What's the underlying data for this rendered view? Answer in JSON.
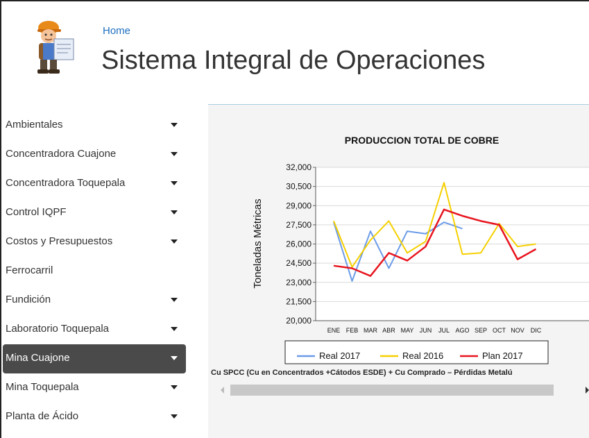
{
  "header": {
    "breadcrumb": "Home",
    "title": "Sistema Integral de Operaciones"
  },
  "sidebar": {
    "items": [
      {
        "label": "Ambientales",
        "has_caret": true,
        "active": false
      },
      {
        "label": "Concentradora Cuajone",
        "has_caret": true,
        "active": false
      },
      {
        "label": "Concentradora Toquepala",
        "has_caret": true,
        "active": false
      },
      {
        "label": "Control IQPF",
        "has_caret": true,
        "active": false
      },
      {
        "label": "Costos y Presupuestos",
        "has_caret": true,
        "active": false
      },
      {
        "label": "Ferrocarril",
        "has_caret": false,
        "active": false
      },
      {
        "label": "Fundición",
        "has_caret": true,
        "active": false
      },
      {
        "label": "Laboratorio Toquepala",
        "has_caret": true,
        "active": false
      },
      {
        "label": "Mina Cuajone",
        "has_caret": true,
        "active": true
      },
      {
        "label": "Mina Toquepala",
        "has_caret": true,
        "active": false
      },
      {
        "label": "Planta de Ácido",
        "has_caret": true,
        "active": false
      }
    ]
  },
  "footer_note": "Cu SPCC (Cu en Concentrados +Cátodos ESDE) + Cu Comprado – Pérdidas Metalú",
  "colors": {
    "real_2017": "#6b9be8",
    "real_2016": "#f5d000",
    "plan_2017": "#e8141e",
    "active_nav_bg": "#4a4a4a",
    "link": "#1e6fc0"
  },
  "icons": {
    "logo": "worker-with-blueprint-icon",
    "nav_caret": "caret-down-icon"
  },
  "chart_data": {
    "type": "line",
    "title": "PRODUCCION TOTAL DE COBRE",
    "xlabel": "",
    "ylabel": "Toneladas Métricas",
    "categories": [
      "ENE",
      "FEB",
      "MAR",
      "ABR",
      "MAY",
      "JUN",
      "JUL",
      "AGO",
      "SEP",
      "OCT",
      "NOV",
      "DIC"
    ],
    "ylim": [
      20000,
      32000
    ],
    "yticks": [
      "20,000",
      "21,500",
      "23,000",
      "24,500",
      "26,000",
      "27,500",
      "29,000",
      "30,500",
      "32,000"
    ],
    "ytick_values": [
      20000,
      21500,
      23000,
      24500,
      26000,
      27500,
      29000,
      30500,
      32000
    ],
    "grid": true,
    "legend_position": "bottom",
    "series": [
      {
        "name": "Real 2017",
        "color": "#6b9be8",
        "values": [
          27700,
          23100,
          27000,
          24100,
          27000,
          26800,
          27700,
          27200,
          null,
          null,
          null,
          null
        ]
      },
      {
        "name": "Real 2016",
        "color": "#f5d000",
        "values": [
          27800,
          24200,
          26300,
          27800,
          25300,
          26200,
          30800,
          25200,
          25300,
          27600,
          25800,
          26000
        ]
      },
      {
        "name": "Plan 2017",
        "color": "#e8141e",
        "values": [
          24300,
          24100,
          23500,
          25300,
          24700,
          25800,
          28700,
          28200,
          27800,
          27500,
          24800,
          25600
        ]
      }
    ]
  }
}
